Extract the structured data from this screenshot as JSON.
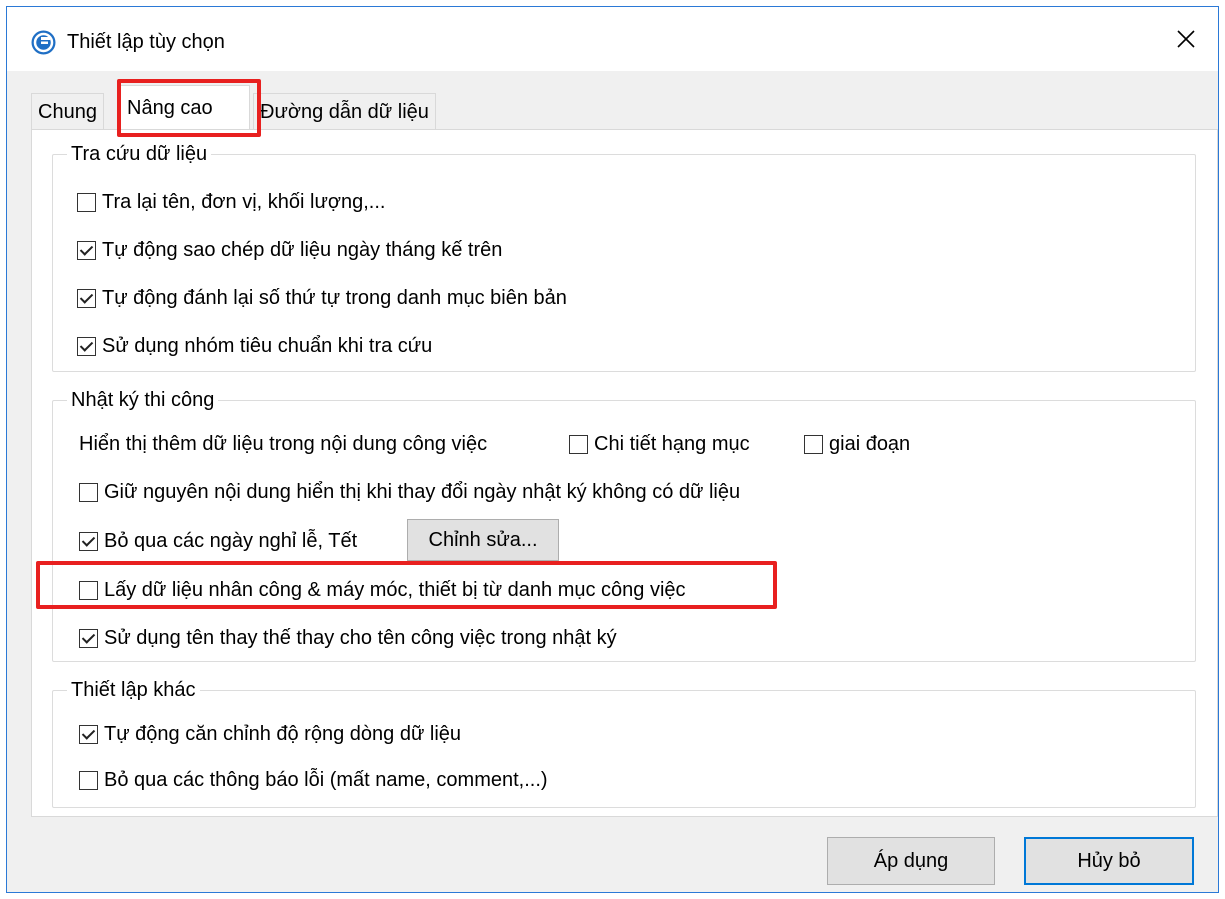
{
  "window": {
    "title": "Thiết lập tùy chọn"
  },
  "tabs": [
    {
      "label": "Chung",
      "active": false
    },
    {
      "label": "Nâng cao",
      "active": true
    },
    {
      "label": "Đường dẫn dữ liệu",
      "active": false
    }
  ],
  "groups": {
    "lookup": {
      "title": "Tra cứu dữ liệu",
      "items": [
        {
          "label": "Tra lại tên, đơn vị, khối lượng,...",
          "checked": false
        },
        {
          "label": "Tự động sao chép dữ liệu ngày tháng kế trên",
          "checked": true
        },
        {
          "label": "Tự động đánh lại số thứ tự trong danh mục biên bản",
          "checked": true
        },
        {
          "label": "Sử dụng nhóm tiêu chuẩn khi tra cứu",
          "checked": true
        }
      ]
    },
    "diary": {
      "title": "Nhật ký thi công",
      "display_extra_label": "Hiển thị thêm dữ liệu trong nội dung công việc",
      "detail_item": {
        "label": "Chi tiết hạng mục",
        "checked": false
      },
      "phase": {
        "label": "giai đoạn",
        "checked": false
      },
      "keep_content": {
        "label": "Giữ nguyên nội dung hiển thị khi thay đổi ngày nhật ký không có dữ liệu",
        "checked": false
      },
      "skip_holidays": {
        "label": "Bỏ qua các ngày nghỉ lễ, Tết",
        "checked": true
      },
      "edit_button": "Chỉnh sửa...",
      "get_resources": {
        "label": "Lấy dữ liệu nhân công & máy móc, thiết bị từ danh mục công việc",
        "checked": false
      },
      "alt_name": {
        "label": "Sử dụng tên thay thế thay cho tên công việc trong nhật ký",
        "checked": true
      }
    },
    "other": {
      "title": "Thiết lập khác",
      "items": [
        {
          "label": "Tự động căn chỉnh độ rộng dòng dữ liệu",
          "checked": true
        },
        {
          "label": "Bỏ qua các thông báo lỗi (mất name, comment,...)",
          "checked": false
        }
      ]
    }
  },
  "buttons": {
    "apply": "Áp dụng",
    "cancel": "Hủy bỏ"
  },
  "colors": {
    "accent": "#0078d7",
    "highlight": "#e8201f"
  }
}
